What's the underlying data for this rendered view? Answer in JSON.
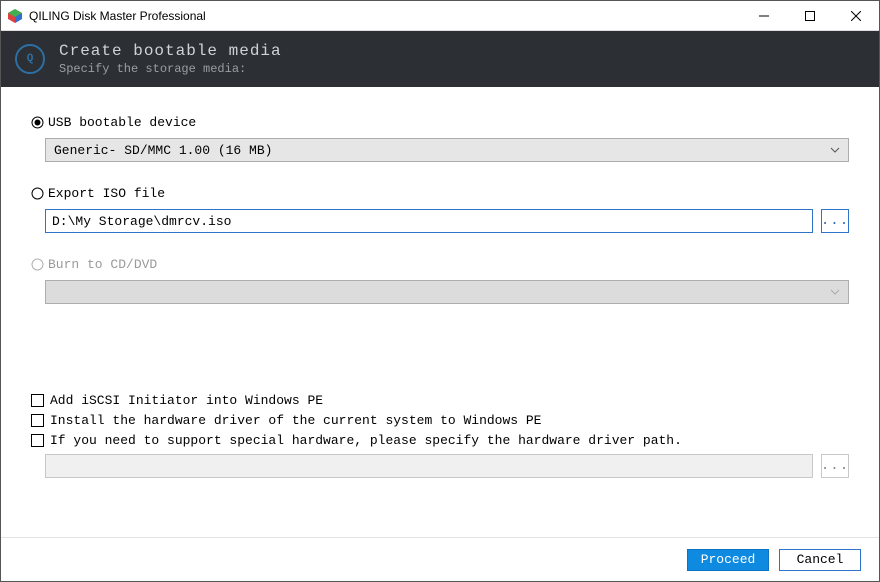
{
  "titlebar": {
    "app_title": "QILING Disk Master Professional"
  },
  "banner": {
    "title": "Create bootable media",
    "subtitle": "Specify the storage media:"
  },
  "options": {
    "usb": {
      "label": "USB bootable device",
      "selected": true,
      "device": "Generic- SD/MMC 1.00 (16 MB)"
    },
    "iso": {
      "label": "Export ISO file",
      "selected": false,
      "path": "D:\\My Storage\\dmrcv.iso",
      "browse_label": "..."
    },
    "cd": {
      "label": "Burn to CD/DVD",
      "enabled": false
    }
  },
  "checks": {
    "iscsi": "Add iSCSI Initiator into Windows PE",
    "driver_current": "Install the hardware driver of the current system to Windows PE",
    "driver_path_label": "If you need to support special hardware, please specify the hardware driver path.",
    "driver_path_value": "",
    "driver_browse_label": "..."
  },
  "footer": {
    "proceed": "Proceed",
    "cancel": "Cancel"
  }
}
